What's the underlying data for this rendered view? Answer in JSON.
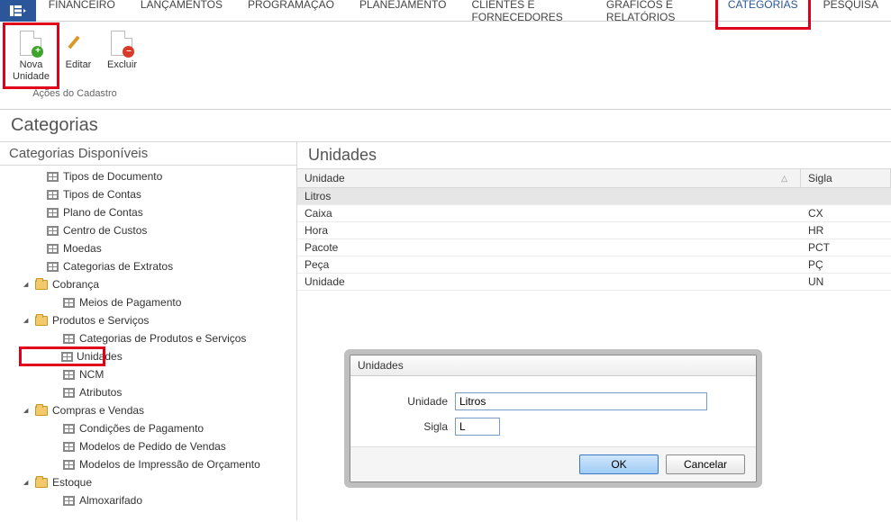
{
  "menu": {
    "items": [
      "FINANCEIRO",
      "LANÇAMENTOS",
      "PROGRAMAÇÃO",
      "PLANEJAMENTO",
      "CLIENTES E FORNECEDORES",
      "GRÁFICOS E RELATÓRIOS",
      "CATEGORIAS",
      "PESQUISA"
    ],
    "active_index": 6
  },
  "ribbon": {
    "group_label": "Ações do Cadastro",
    "nova_unidade": "Nova\nUnidade",
    "editar": "Editar",
    "excluir": "Excluir"
  },
  "page_title": "Categorias",
  "sidebar": {
    "header": "Categorias Disponíveis",
    "items": [
      {
        "type": "leaf",
        "label": "Tipos de Documento"
      },
      {
        "type": "leaf",
        "label": "Tipos de Contas"
      },
      {
        "type": "leaf",
        "label": "Plano de Contas"
      },
      {
        "type": "leaf",
        "label": "Centro de Custos"
      },
      {
        "type": "leaf",
        "label": "Moedas"
      },
      {
        "type": "leaf",
        "label": "Categorias de Extratos"
      },
      {
        "type": "folder",
        "label": "Cobrança"
      },
      {
        "type": "leaf2",
        "label": "Meios de Pagamento"
      },
      {
        "type": "folder",
        "label": "Produtos e Serviços"
      },
      {
        "type": "leaf2",
        "label": "Categorias de Produtos e Serviços"
      },
      {
        "type": "leaf2",
        "label": "Unidades",
        "highlight": true
      },
      {
        "type": "leaf2",
        "label": "NCM"
      },
      {
        "type": "leaf2",
        "label": "Atributos"
      },
      {
        "type": "folder",
        "label": "Compras e Vendas"
      },
      {
        "type": "leaf2",
        "label": "Condições de Pagamento"
      },
      {
        "type": "leaf2",
        "label": "Modelos de Pedido de Vendas"
      },
      {
        "type": "leaf2",
        "label": "Modelos de Impressão de Orçamento"
      },
      {
        "type": "folder",
        "label": "Estoque"
      },
      {
        "type": "leaf2",
        "label": "Almoxarifado"
      }
    ]
  },
  "main": {
    "header": "Unidades",
    "columns": {
      "unidade": "Unidade",
      "sigla": "Sigla"
    },
    "rows": [
      {
        "unidade": "Litros",
        "sigla": "",
        "selected": true
      },
      {
        "unidade": "Caixa",
        "sigla": "CX"
      },
      {
        "unidade": "Hora",
        "sigla": "HR"
      },
      {
        "unidade": "Pacote",
        "sigla": "PCT"
      },
      {
        "unidade": "Peça",
        "sigla": "PÇ"
      },
      {
        "unidade": "Unidade",
        "sigla": "UN"
      }
    ]
  },
  "dialog": {
    "title": "Unidades",
    "label_unidade": "Unidade",
    "label_sigla": "Sigla",
    "value_unidade": "Litros",
    "value_sigla": "L",
    "ok": "OK",
    "cancel": "Cancelar"
  }
}
